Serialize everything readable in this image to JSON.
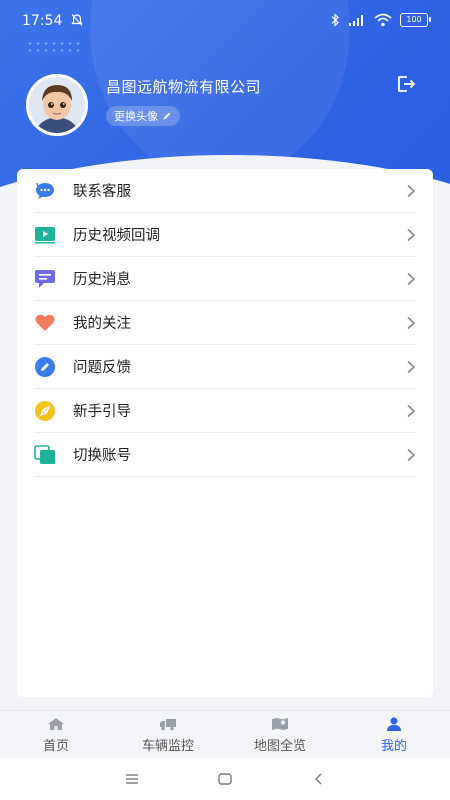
{
  "status": {
    "time": "17:54",
    "battery": "100"
  },
  "profile": {
    "company": "昌图远航物流有限公司",
    "change_avatar": "更换头像"
  },
  "menu": [
    {
      "label": "联系客服",
      "icon": "chat-bubble-icon"
    },
    {
      "label": "历史视频回调",
      "icon": "video-play-icon"
    },
    {
      "label": "历史消息",
      "icon": "message-icon"
    },
    {
      "label": "我的关注",
      "icon": "heart-icon"
    },
    {
      "label": "问题反馈",
      "icon": "feedback-pencil-icon"
    },
    {
      "label": "新手引导",
      "icon": "compass-icon"
    },
    {
      "label": "切换账号",
      "icon": "switch-account-icon"
    }
  ],
  "tabs": [
    {
      "label": "首页",
      "icon": "home-icon"
    },
    {
      "label": "车辆监控",
      "icon": "truck-icon"
    },
    {
      "label": "地图全览",
      "icon": "map-icon"
    },
    {
      "label": "我的",
      "icon": "user-icon",
      "active": true
    }
  ],
  "colors": {
    "primary": "#2f63e4",
    "heart": "#f07a5b",
    "feedback": "#3a7cf0",
    "compass": "#f4c21c",
    "video": "#1fb39a",
    "message": "#6f6be8"
  }
}
